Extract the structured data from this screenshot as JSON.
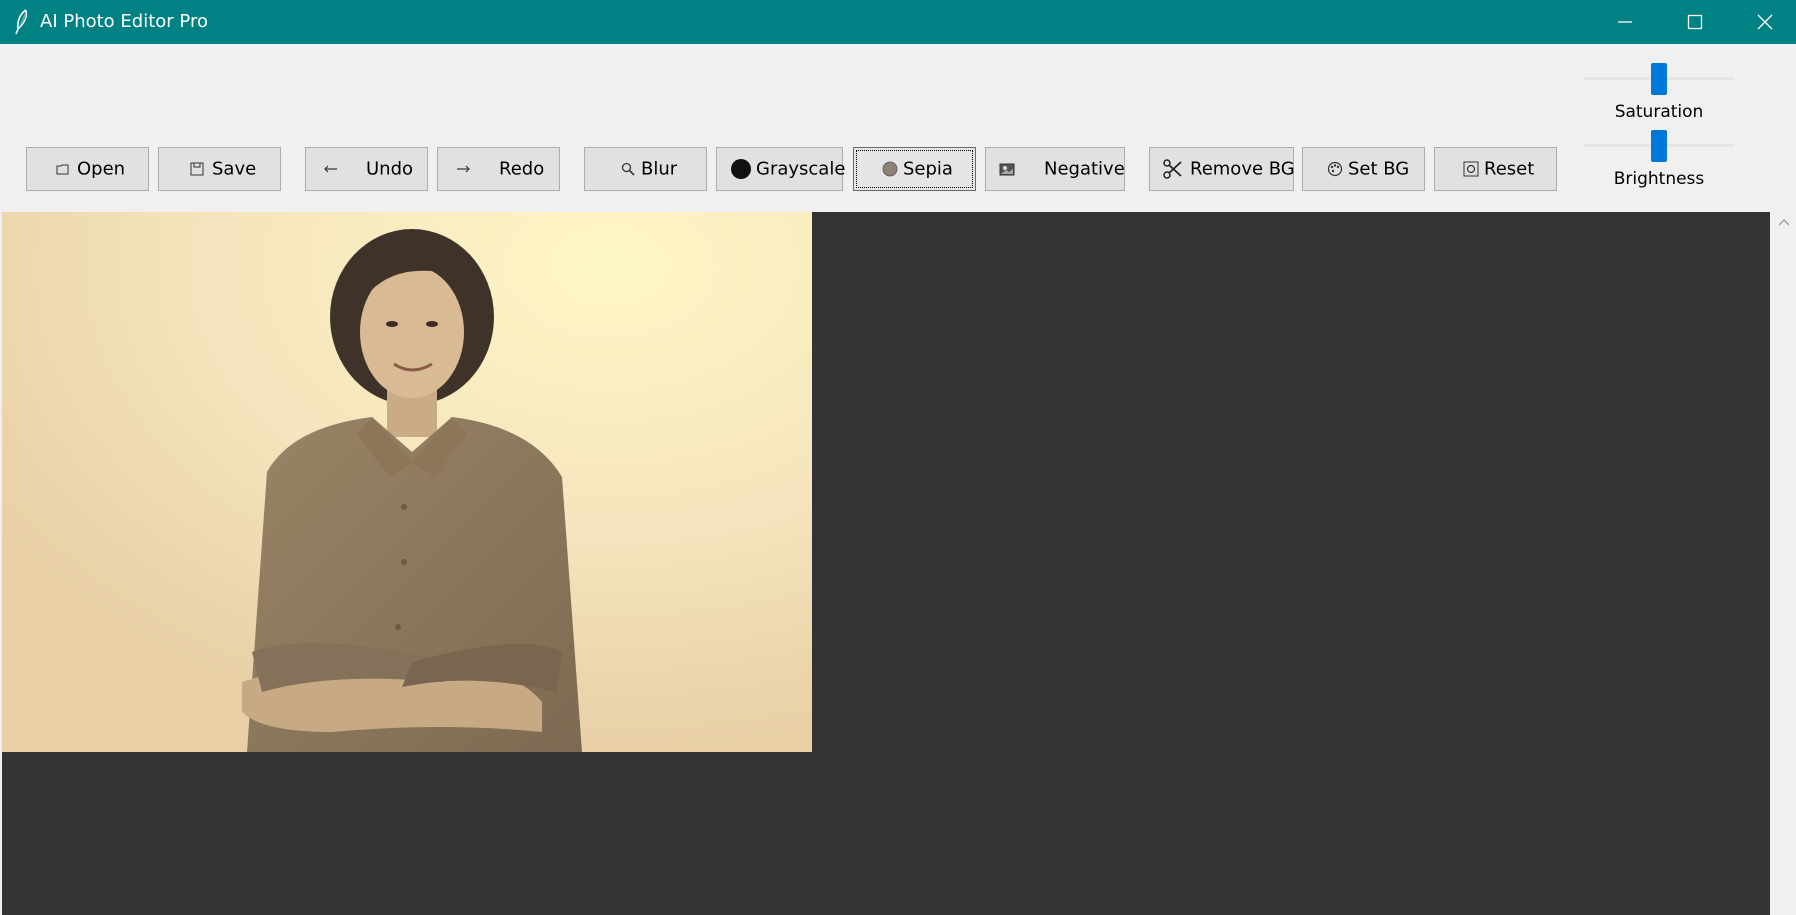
{
  "window": {
    "title": "AI Photo Editor Pro",
    "app_icon": "feather-icon",
    "controls": [
      "minimize-icon",
      "maximize-icon",
      "close-icon"
    ]
  },
  "toolbar": {
    "open": "Open",
    "save": "Save",
    "undo": "Undo",
    "redo": "Redo",
    "blur": "Blur",
    "grayscale": "Grayscale",
    "sepia": "Sepia",
    "negative": "Negative",
    "remove_bg": "Remove BG",
    "set_bg": "Set BG",
    "reset": "Reset"
  },
  "adjustments": {
    "saturation": {
      "label": "Saturation",
      "value_fraction": 0.5
    },
    "brightness": {
      "label": "Brightness",
      "value_fraction": 0.5
    }
  },
  "colors": {
    "titlebar": "#008184",
    "canvas_bg": "#333333",
    "slider_accent": "#0078d7",
    "sepia_tone": "#f5e6b8"
  },
  "canvas": {
    "image_subject": "sepia-toned portrait of a smiling woman with arms crossed"
  }
}
